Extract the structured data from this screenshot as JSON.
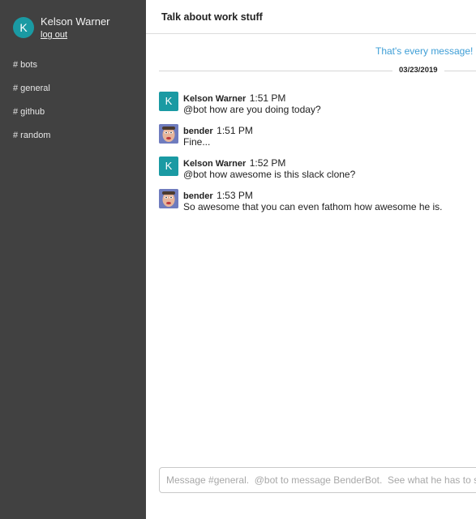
{
  "user": {
    "avatar_letter": "K",
    "name": "Kelson Warner",
    "logout_label": "log out"
  },
  "channels": [
    "# bots",
    "# general",
    "# github",
    "# random"
  ],
  "header": {
    "title": "Talk about work stuff"
  },
  "history": {
    "end_label": "That's every message!",
    "date": "03/23/2019"
  },
  "messages": [
    {
      "author": "Kelson Warner",
      "time": "1:51 PM",
      "text": "@bot how are you doing today?",
      "avatar": "K"
    },
    {
      "author": "bender",
      "time": "1:51 PM",
      "text": "Fine...",
      "avatar": "bender-icon"
    },
    {
      "author": "Kelson Warner",
      "time": "1:52 PM",
      "text": "@bot how awesome is this slack clone?",
      "avatar": "K"
    },
    {
      "author": "bender",
      "time": "1:53 PM",
      "text": "So awesome that you can even fathom how awesome he is.",
      "avatar": "bender-icon"
    }
  ],
  "composer": {
    "placeholder": "Message #general.  @bot to message BenderBot.  See what he has to say!"
  },
  "colors": {
    "sidebar": "#414141",
    "accent": "#1a9aa3",
    "link": "#3e9ed6"
  }
}
